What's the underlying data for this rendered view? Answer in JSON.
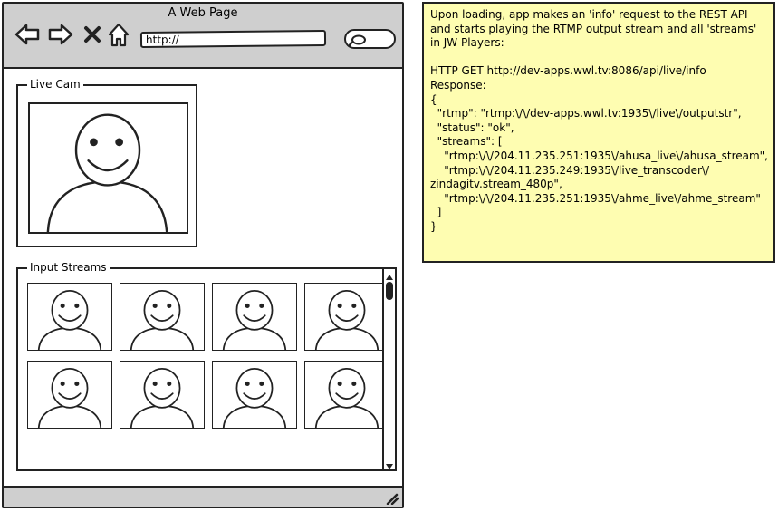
{
  "window": {
    "title": "A Web Page",
    "url_value": "http://",
    "nav_icons": [
      "back-arrow-icon",
      "forward-arrow-icon",
      "close-x-icon",
      "home-icon"
    ],
    "search_icon": "search-icon"
  },
  "live_cam": {
    "label": "Live Cam",
    "placeholder_icon": "user-avatar-icon"
  },
  "input_streams": {
    "label": "Input Streams",
    "thumbnail_icon": "user-avatar-icon",
    "visible_thumbnails": 8
  },
  "note": {
    "intro": "Upon loading, app makes an 'info' request to the REST API and starts playing the RTMP output stream and all 'streams' in JW Players:",
    "lines": [
      "HTTP GET http://dev-apps.wwl.tv:8086/api/live/info",
      "Response:",
      "{",
      "  \"rtmp\": \"rtmp:\\/\\/dev-apps.wwl.tv:1935\\/live\\/outputstr\",",
      "  \"status\": \"ok\",",
      "  \"streams\": [",
      "    \"rtmp:\\/\\/204.11.235.251:1935\\/ahusa_live\\/ahusa_stream\",",
      "    \"rtmp:\\/\\/204.11.235.249:1935\\/live_transcoder\\/",
      "zindagitv.stream_480p\",",
      "    \"rtmp:\\/\\/204.11.235.251:1935\\/ahme_live\\/ahme_stream\"",
      "  ]",
      "}"
    ],
    "background": "#fefdb1"
  },
  "colors": {
    "chrome": "#cfcfcf",
    "stroke": "#222222",
    "note": "#fefdb1"
  }
}
